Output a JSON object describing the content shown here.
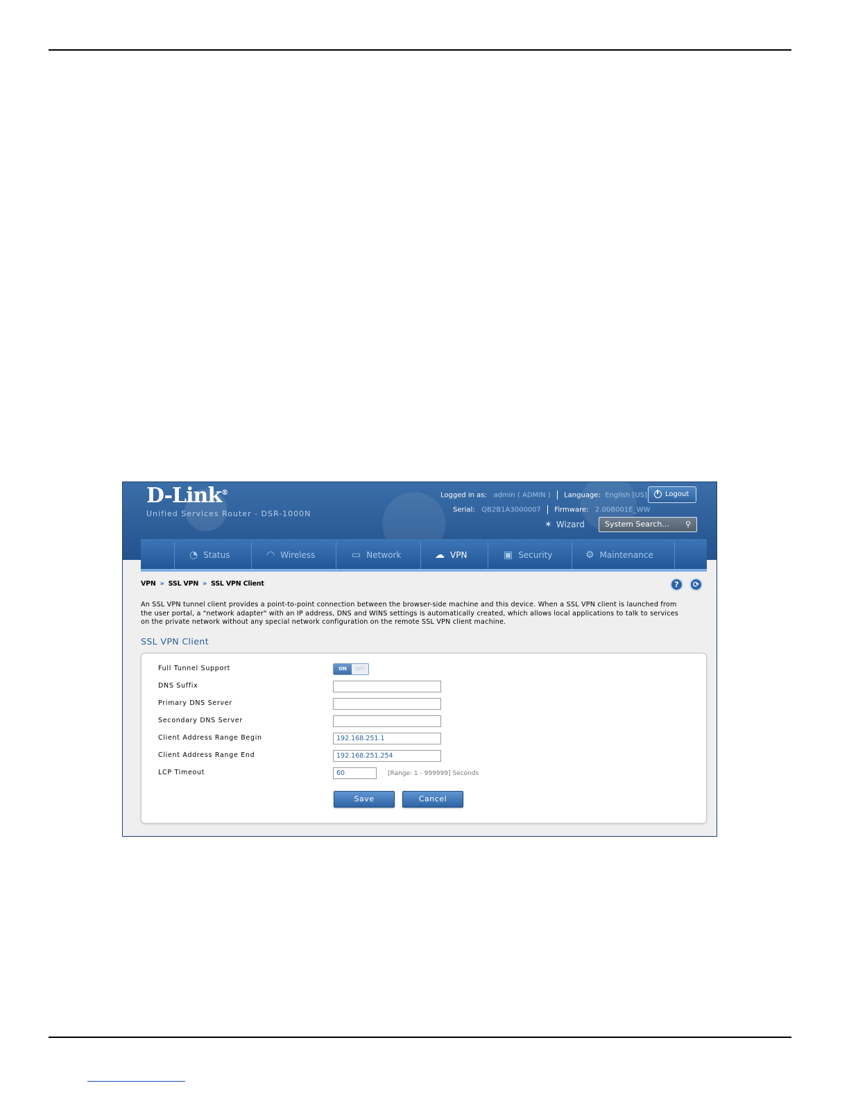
{
  "brand": {
    "logo": "D-Link",
    "logo_mark": "®",
    "subtitle": "Unified Services Router - DSR-1000N"
  },
  "account": {
    "logged_in_label": "Logged in as:",
    "user": "admin ( ADMIN )",
    "language_label": "Language:",
    "language": "English [US]",
    "serial_label": "Serial:",
    "serial": "QB2B1A3000007",
    "firmware_label": "Firmware:",
    "firmware": "2.00B001E_WW",
    "logout_label": "Logout"
  },
  "tools": {
    "wizard_label": "Wizard",
    "search_placeholder": "System Search..."
  },
  "nav": {
    "items": [
      {
        "label": "Status",
        "icon": "gauge-icon"
      },
      {
        "label": "Wireless",
        "icon": "wifi-icon"
      },
      {
        "label": "Network",
        "icon": "monitor-icon"
      },
      {
        "label": "VPN",
        "icon": "cloud-lock-icon",
        "active": true
      },
      {
        "label": "Security",
        "icon": "lock-icon"
      },
      {
        "label": "Maintenance",
        "icon": "gears-icon"
      }
    ]
  },
  "breadcrumb": [
    "VPN",
    "SSL VPN",
    "SSL VPN Client"
  ],
  "breadcrumb_sep": "»",
  "help": {
    "help_glyph": "?",
    "refresh_glyph": "⟳"
  },
  "description": "An SSL VPN tunnel client provides a point-to-point connection between the browser-side machine and this device. When a SSL VPN client is launched from the user portal, a \"network adapter\" with an IP address, DNS and WINS settings is automatically created, which allows local applications to talk to services on the private network without any special network configuration on the remote SSL VPN client machine.",
  "section_title": "SSL VPN Client",
  "form": {
    "full_tunnel_label": "Full Tunnel Support",
    "toggle_on": "ON",
    "toggle_off": "OFF",
    "dns_suffix_label": "DNS Suffix",
    "dns_suffix_value": "",
    "primary_dns_label": "Primary DNS Server",
    "primary_dns_value": "",
    "secondary_dns_label": "Secondary DNS Server",
    "secondary_dns_value": "",
    "range_begin_label": "Client Address Range Begin",
    "range_begin_value": "192.168.251.1",
    "range_end_label": "Client Address Range End",
    "range_end_value": "192.168.251.254",
    "lcp_label": "LCP Timeout",
    "lcp_value": "60",
    "lcp_hint": "[Range: 1 - 999999] Seconds",
    "save_label": "Save",
    "cancel_label": "Cancel"
  },
  "colors": {
    "header_blue": "#24528e",
    "nav_blue": "#1f5596",
    "accent": "#2a5f9e"
  }
}
